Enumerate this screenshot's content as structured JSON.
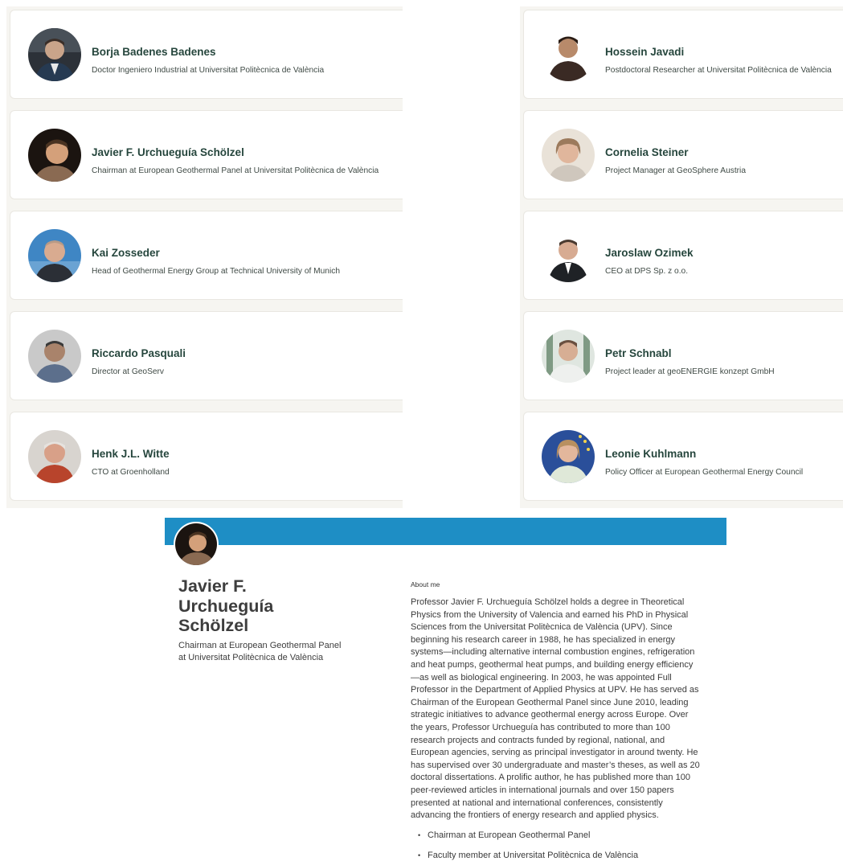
{
  "left_cards": [
    {
      "name": "Borja Badenes Badenes",
      "role": "Doctor Ingeniero Industrial at Universitat Politècnica de València",
      "avatar": "person-photo-icon"
    },
    {
      "name": "Javier F. Urchueguía Schölzel",
      "role": "Chairman at European Geothermal Panel at Universitat Politècnica de València",
      "avatar": "person-photo-icon"
    },
    {
      "name": "Kai Zosseder",
      "role": "Head of Geothermal Energy Group at Technical University of Munich",
      "avatar": "person-photo-icon"
    },
    {
      "name": "Riccardo Pasquali",
      "role": "Director at GeoServ",
      "avatar": "person-photo-icon"
    },
    {
      "name": "Henk J.L. Witte",
      "role": "CTO at Groenholland",
      "avatar": "person-photo-icon"
    }
  ],
  "right_cards": [
    {
      "name": "Hossein Javadi",
      "role": "Postdoctoral Researcher at Universitat Politècnica de València",
      "avatar": "person-photo-icon"
    },
    {
      "name": "Cornelia Steiner",
      "role": "Project Manager at GeoSphere Austria",
      "avatar": "person-photo-icon"
    },
    {
      "name": "Jaroslaw Ozimek",
      "role": "CEO at DPS Sp. z o.o.",
      "avatar": "person-photo-icon"
    },
    {
      "name": "Petr Schnabl",
      "role": "Project leader at geoENERGIE konzept GmbH",
      "avatar": "person-photo-icon"
    },
    {
      "name": "Leonie Kuhlmann",
      "role": "Policy Officer at European Geothermal Energy Council",
      "avatar": "person-photo-icon"
    }
  ],
  "profile": {
    "header_color": "#1e8ec5",
    "name_lines": [
      "Javier F.",
      "Urchueguía",
      "Schölzel"
    ],
    "role_lines": [
      "Chairman at European Geothermal Panel",
      "at Universitat Politècnica de València"
    ],
    "about_label": "About me",
    "about_lines": [
      "Professor Javier F. Urchueguía Schölzel holds a degree in Theoretical",
      "Physics from the University of Valencia and earned his PhD in Physical",
      "Sciences from the Universitat Politècnica de València (UPV). Since",
      "beginning his research career in 1988, he has specialized in energy",
      "systems—including alternative internal combustion engines, refrigeration",
      "and heat pumps, geothermal heat pumps, and building energy efficiency",
      "—as well as biological engineering. In 2003, he was appointed Full",
      "Professor in the Department of Applied Physics at UPV. He has served as",
      "Chairman of the European Geothermal Panel since June 2010, leading",
      "strategic initiatives to advance geothermal energy across Europe. Over",
      "the years, Professor Urchueguía has contributed to more than 100",
      "research projects and contracts funded by regional, national, and",
      "European agencies, serving as principal investigator in around twenty. He",
      "has supervised over 30 undergraduate and master’s theses, as well as 20",
      "doctoral dissertations. A prolific author, he has published more than 100",
      "peer-reviewed articles in international journals and over 150 papers",
      "presented at national and international conferences, consistently",
      "advancing the frontiers of energy research and applied physics."
    ],
    "bullets": [
      "Chairman at European Geothermal Panel",
      "Faculty member at Universitat Politècnica de València"
    ]
  }
}
